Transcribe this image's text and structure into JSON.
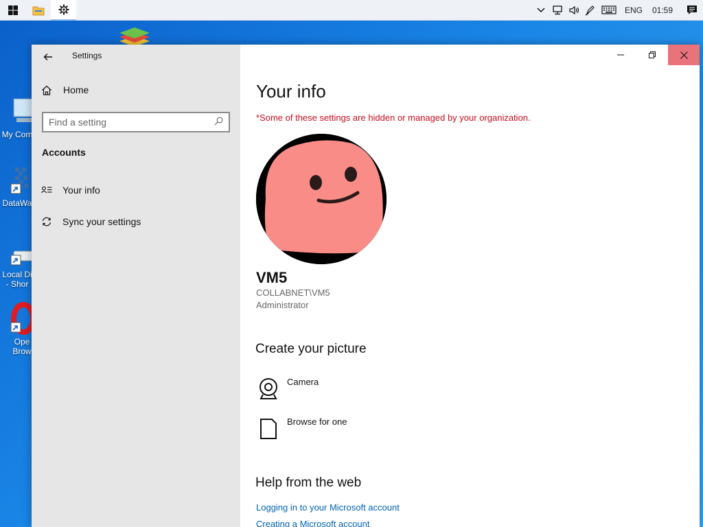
{
  "taskbar": {
    "tray": {
      "language": "ENG",
      "clock": "01:59"
    }
  },
  "desktop": {
    "icons": [
      {
        "label_1": "My Com",
        "label_2": ""
      },
      {
        "label_1": "DataWa",
        "label_2": ""
      },
      {
        "label_1": "Local Di",
        "label_2": "- Shor"
      },
      {
        "label_1": "Ope",
        "label_2": "Brow"
      }
    ]
  },
  "window": {
    "title": "Settings",
    "sidebar": {
      "home_label": "Home",
      "search_placeholder": "Find a setting",
      "section_title": "Accounts",
      "items": [
        {
          "label": "Your info",
          "icon": "person-card-icon"
        },
        {
          "label": "Sync your settings",
          "icon": "sync-icon"
        }
      ]
    },
    "main": {
      "title": "Your info",
      "notice": "*Some of these settings are hidden or managed by your organization.",
      "user": {
        "name": "VM5",
        "domain": "COLLABNET\\VM5",
        "role": "Administrator"
      },
      "create_picture": {
        "heading": "Create your picture",
        "options": [
          {
            "label": "Camera",
            "icon": "camera-icon"
          },
          {
            "label": "Browse for one",
            "icon": "document-icon"
          }
        ]
      },
      "help": {
        "heading": "Help from the web",
        "links": [
          "Logging in to your Microsoft account",
          "Creating a Microsoft account"
        ]
      }
    }
  },
  "colors": {
    "sidebar_bg": "#e6e6e6",
    "close_button": "#e9727b",
    "notice_red": "#c50f1f",
    "link_blue": "#0063b1",
    "avatar_pink": "#fa8c88"
  }
}
